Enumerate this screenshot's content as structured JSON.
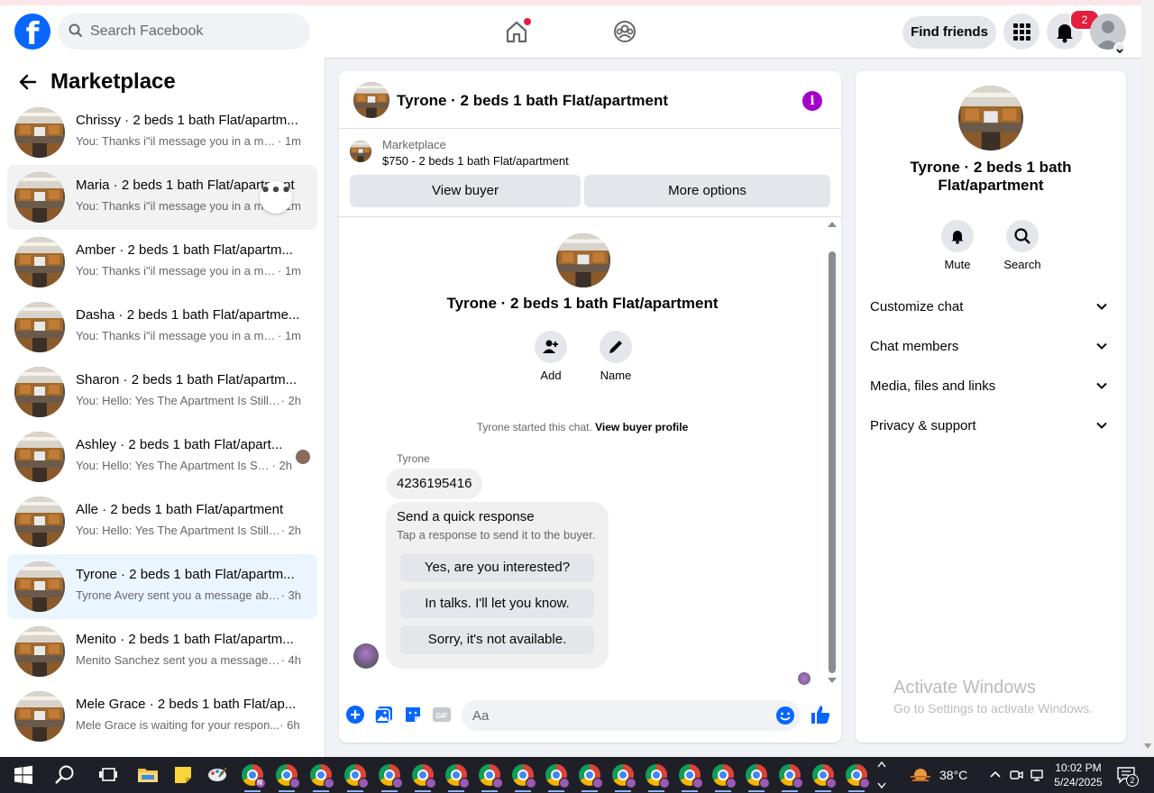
{
  "topbar": {
    "logo": "f",
    "search_placeholder": "Search Facebook",
    "find_friends": "Find friends",
    "notifications_count": "2"
  },
  "sidebar": {
    "title": "Marketplace",
    "conversations": [
      {
        "name": "Chrissy · 2 beds 1 bath Flat/apartm...",
        "snippet": "You: Thanks i\"il message you in a mo...",
        "time": " · 1m"
      },
      {
        "name": "Maria · 2 beds 1 bath Flat/apartment",
        "snippet": "You: Thanks i\"il message you in a mo...",
        "time": " · 1m"
      },
      {
        "name": "Amber · 2 beds 1 bath Flat/apartm...",
        "snippet": "You: Thanks i\"il message you in a mo...",
        "time": " · 1m"
      },
      {
        "name": "Dasha · 2 beds 1 bath Flat/apartme...",
        "snippet": "You: Thanks i\"il message you in a mo...",
        "time": " · 1m"
      },
      {
        "name": "Sharon · 2 beds 1 bath Flat/apartm...",
        "snippet": "You: Hello: Yes The Apartment Is Still ...",
        "time": " · 2h"
      },
      {
        "name": "Ashley · 2 beds 1 bath Flat/apart...",
        "snippet": "You: Hello: Yes The Apartment Is Sti...",
        "time": " · 2h"
      },
      {
        "name": "Alle · 2 beds 1 bath Flat/apartment",
        "snippet": "You: Hello: Yes The Apartment Is Still ...",
        "time": " · 2h"
      },
      {
        "name": "Tyrone · 2 beds 1 bath Flat/apartm...",
        "snippet": "Tyrone Avery sent you a message abo...",
        "time": " · 3h"
      },
      {
        "name": "Menito · 2 beds 1 bath Flat/apartm...",
        "snippet": "Menito Sanchez sent you a message a...",
        "time": " · 4h"
      },
      {
        "name": "Mele Grace · 2 beds 1 bath Flat/ap...",
        "snippet": "Mele Grace is waiting for your respon...",
        "time": " · 6h"
      }
    ]
  },
  "chat": {
    "title": "Tyrone · 2 beds 1 bath Flat/apartment",
    "listing_category": "Marketplace",
    "listing_price": "$750 - 2 beds 1 bath Flat/apartment",
    "view_buyer": "View buyer",
    "more_options": "More options",
    "intro_title": "Tyrone · 2 beds 1 bath Flat/apartment",
    "add_label": "Add",
    "name_label": "Name",
    "started_text": "Tyrone started this chat.",
    "view_profile": "View buyer profile",
    "sender": "Tyrone",
    "message": "4236195416",
    "quick_title": "Send a quick response",
    "quick_sub": "Tap a response to send it to the buyer.",
    "quick_replies": [
      "Yes, are you interested?",
      "In talks. I'll let you know.",
      "Sorry, it's not available."
    ],
    "composer_placeholder": "Aa"
  },
  "details": {
    "title": "Tyrone · 2 beds 1 bath Flat/apartment",
    "mute": "Mute",
    "search": "Search",
    "rows": [
      "Customize chat",
      "Chat members",
      "Media, files and links",
      "Privacy & support"
    ],
    "activate_title": "Activate Windows",
    "activate_sub": "Go to Settings to activate Windows."
  },
  "taskbar": {
    "temperature": "38°C",
    "time": "10:02 PM",
    "date": "5/24/2025",
    "notification_count": "2"
  },
  "colors": {
    "facebook_blue": "#0866ff",
    "badge_red": "#e41e3f",
    "info_purple": "#a200cc",
    "active_conversation": "#ebf5ff"
  }
}
